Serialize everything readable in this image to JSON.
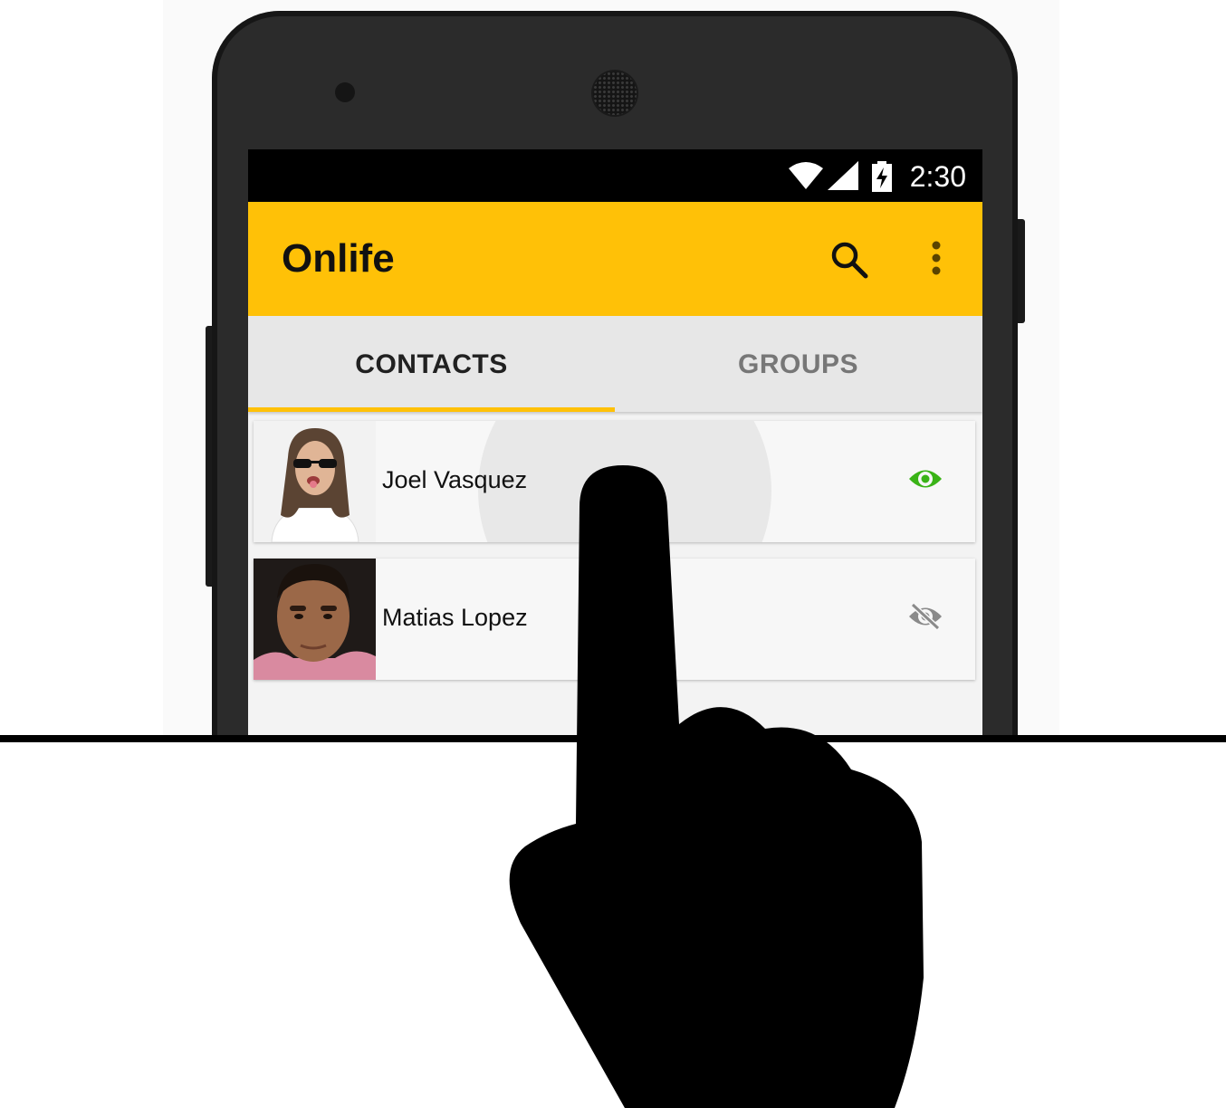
{
  "status_bar": {
    "time": "2:30",
    "icons": [
      "wifi-icon",
      "signal-icon",
      "battery-charging-icon"
    ]
  },
  "app_bar": {
    "title": "Onlife",
    "actions": [
      "search-icon",
      "more-vert-icon"
    ]
  },
  "tabs": [
    {
      "label": "CONTACTS",
      "selected": true
    },
    {
      "label": "GROUPS",
      "selected": false
    }
  ],
  "contacts": [
    {
      "name": "Joel Vasquez",
      "visibility_icon": "visibility-icon",
      "visible": true
    },
    {
      "name": "Matias Lopez",
      "visibility_icon": "visibility-off-icon",
      "visible": false
    }
  ],
  "colors": {
    "accent": "#ffc107",
    "visible_green": "#3ab317",
    "hidden_grey": "#8a8a8a"
  },
  "overlay": {
    "gesture": "tap",
    "icon": "pointing-hand-icon"
  }
}
